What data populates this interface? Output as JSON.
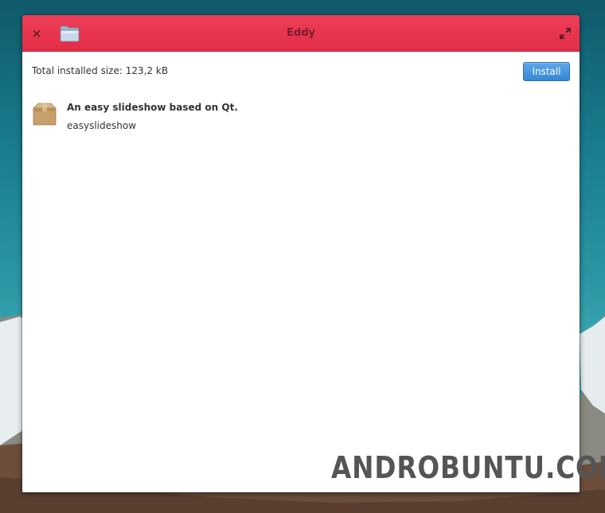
{
  "window": {
    "title": "Eddy",
    "close_symbol": "×",
    "icons": {
      "close": "close-icon",
      "app": "folder-icon",
      "maximize": "maximize-icon"
    }
  },
  "content": {
    "size_label": "Total installed size: 123,2 kB",
    "install_label": "Install",
    "package": {
      "summary": "An easy slideshow based on Qt.",
      "name": "easyslideshow",
      "icon": "package-icon"
    }
  },
  "watermark": {
    "text": "ANDROBUNTU.COM"
  },
  "colors": {
    "titlebar": "#e22d47",
    "accent": "#3588d5",
    "text": "#333333"
  }
}
